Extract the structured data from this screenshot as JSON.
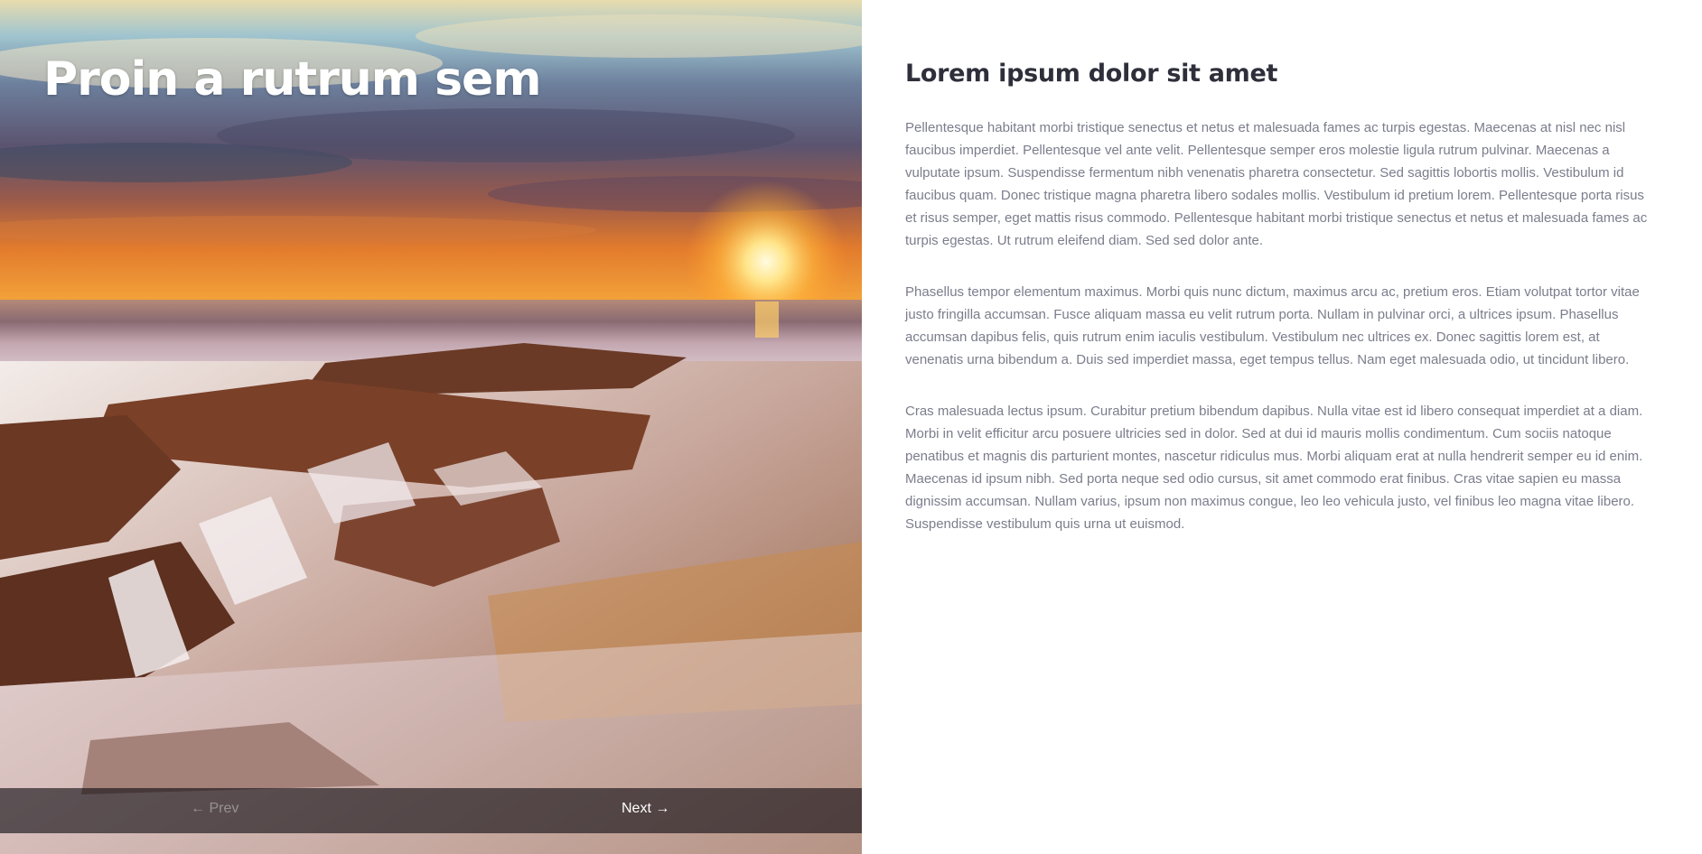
{
  "slide": {
    "title": "Proin a rutrum sem",
    "image": "sunset-seascape-waterfall-rocks",
    "nav": {
      "prev_label": "← Prev",
      "next_label": "Next →"
    }
  },
  "content": {
    "title": "Lorem ipsum dolor sit amet",
    "paragraphs": [
      "Pellentesque habitant morbi tristique senectus et netus et malesuada fames ac turpis egestas. Maecenas at nisl nec nisl faucibus imperdiet. Pellentesque vel ante velit. Pellentesque semper eros molestie ligula rutrum pulvinar. Maecenas a vulputate ipsum. Suspendisse fermentum nibh venenatis pharetra consectetur. Sed sagittis lobortis mollis. Vestibulum id faucibus quam. Donec tristique magna pharetra libero sodales mollis. Vestibulum id pretium lorem. Pellentesque porta risus et risus semper, eget mattis risus commodo. Pellentesque habitant morbi tristique senectus et netus et malesuada fames ac turpis egestas. Ut rutrum eleifend diam. Sed sed dolor ante.",
      "Phasellus tempor elementum maximus. Morbi quis nunc dictum, maximus arcu ac, pretium eros. Etiam volutpat tortor vitae justo fringilla accumsan. Fusce aliquam massa eu velit rutrum porta. Nullam in pulvinar orci, a ultrices ipsum. Phasellus accumsan dapibus felis, quis rutrum enim iaculis vestibulum. Vestibulum nec ultrices ex. Donec sagittis lorem est, at venenatis urna bibendum a. Duis sed imperdiet massa, eget tempus tellus. Nam eget malesuada odio, ut tincidunt libero.",
      "Cras malesuada lectus ipsum. Curabitur pretium bibendum dapibus. Nulla vitae est id libero consequat imperdiet at a diam. Morbi in velit efficitur arcu posuere ultricies sed in dolor. Sed at dui id mauris mollis condimentum. Cum sociis natoque penatibus et magnis dis parturient montes, nascetur ridiculus mus. Morbi aliquam erat at nulla hendrerit semper eu id enim. Maecenas id ipsum nibh. Sed porta neque sed odio cursus, sit amet commodo erat finibus. Cras vitae sapien eu massa dignissim accumsan. Nullam varius, ipsum non maximus congue, leo leo vehicula justo, vel finibus leo magna vitae libero. Suspendisse vestibulum quis urna ut euismod."
    ]
  },
  "colors": {
    "title_text": "#2e2f3a",
    "body_text": "#7b7d8c",
    "slide_title": "#ffffff",
    "nav_bar": "#0f0c12"
  }
}
